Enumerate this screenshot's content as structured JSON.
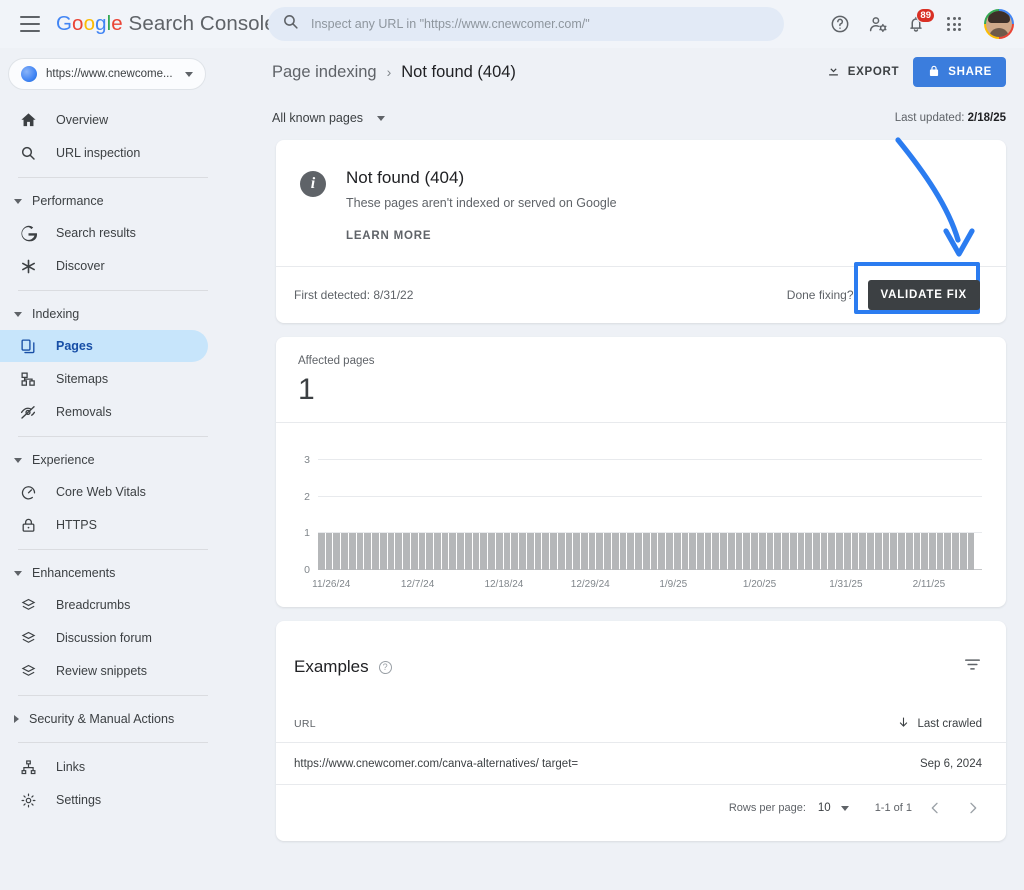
{
  "app": {
    "brand_google": "Google",
    "brand_suffix": " Search Console",
    "menu_icon": "hamburger-icon"
  },
  "search": {
    "placeholder": "Inspect any URL in \"https://www.cnewcomer.com/\"",
    "value": "",
    "icon": "search-icon"
  },
  "top_icons": {
    "help": "help-icon",
    "user_settings": "user-settings-icon",
    "notifications": "bell-icon",
    "notifications_badge": "89",
    "apps": "apps-grid-icon",
    "account": "avatar"
  },
  "sidebar": {
    "property": {
      "label": "https://www.cnewcome...",
      "icon": "globe-icon"
    },
    "items": [
      {
        "label": "Overview",
        "icon": "home-icon",
        "type": "item",
        "active": false
      },
      {
        "label": "URL inspection",
        "icon": "search-icon",
        "type": "item",
        "active": false
      },
      {
        "label": "Performance",
        "icon": "chevron-down-icon",
        "type": "group",
        "expanded": true
      },
      {
        "label": "Search results",
        "icon": "google-g-icon",
        "type": "item",
        "active": false
      },
      {
        "label": "Discover",
        "icon": "asterisk-icon",
        "type": "item",
        "active": false
      },
      {
        "label": "Indexing",
        "icon": "chevron-down-icon",
        "type": "group",
        "expanded": true
      },
      {
        "label": "Pages",
        "icon": "pages-icon",
        "type": "item",
        "active": true
      },
      {
        "label": "Sitemaps",
        "icon": "sitemap-icon",
        "type": "item",
        "active": false
      },
      {
        "label": "Removals",
        "icon": "eye-off-icon",
        "type": "item",
        "active": false
      },
      {
        "label": "Experience",
        "icon": "chevron-down-icon",
        "type": "group",
        "expanded": true
      },
      {
        "label": "Core Web Vitals",
        "icon": "speedometer-icon",
        "type": "item",
        "active": false
      },
      {
        "label": "HTTPS",
        "icon": "lock-icon",
        "type": "item",
        "active": false
      },
      {
        "label": "Enhancements",
        "icon": "chevron-down-icon",
        "type": "group",
        "expanded": true
      },
      {
        "label": "Breadcrumbs",
        "icon": "layers-icon",
        "type": "item",
        "active": false
      },
      {
        "label": "Discussion forum",
        "icon": "layers-icon",
        "type": "item",
        "active": false
      },
      {
        "label": "Review snippets",
        "icon": "layers-icon",
        "type": "item",
        "active": false
      },
      {
        "label": "Security & Manual Actions",
        "icon": "chevron-right-icon",
        "type": "group",
        "expanded": false
      },
      {
        "label": "Links",
        "icon": "links-icon",
        "type": "item",
        "active": false
      },
      {
        "label": "Settings",
        "icon": "gear-icon",
        "type": "item",
        "active": false
      }
    ]
  },
  "header": {
    "breadcrumb_parent": "Page indexing",
    "breadcrumb_separator": "›",
    "breadcrumb_current": "Not found (404)",
    "export_label": "EXPORT",
    "export_icon": "download-icon",
    "share_label": "SHARE",
    "share_icon": "lock-icon"
  },
  "filters": {
    "known_pages_label": "All known pages",
    "known_pages_icon": "chevron-down-icon",
    "last_updated_prefix": "Last updated: ",
    "last_updated_value": "2/18/25"
  },
  "status_card": {
    "icon": "info-icon",
    "icon_glyph": "i",
    "title": "Not found (404)",
    "subtitle": "These pages aren't indexed or served on Google",
    "learn_more": "LEARN MORE",
    "first_detected": "First detected: 8/31/22",
    "done_fixing": "Done fixing?",
    "validate_label": "VALIDATE FIX",
    "highlight_color": "#2b7cf0",
    "validate_bg": "#3c4043",
    "annotation_arrow": "curved-arrow-icon"
  },
  "chart_card": {
    "affected_label": "Affected pages",
    "affected_value": "1"
  },
  "chart_data": {
    "type": "bar",
    "title": "Affected pages",
    "xlabel": "",
    "ylabel": "",
    "ylim": [
      0,
      3
    ],
    "yticks": [
      "0",
      "1",
      "2",
      "3"
    ],
    "grid": true,
    "legend": "none",
    "tick_labels": [
      "11/26/24",
      "12/7/24",
      "12/18/24",
      "12/29/24",
      "1/9/25",
      "1/20/25",
      "1/31/25",
      "2/11/25"
    ],
    "tick_positions_pct": [
      2.0,
      15.0,
      28.0,
      41.0,
      53.5,
      66.5,
      79.5,
      92.0
    ],
    "bar_color": "#b5b7b9",
    "n_bars": 85,
    "values": [
      1,
      1,
      1,
      1,
      1,
      1,
      1,
      1,
      1,
      1,
      1,
      1,
      1,
      1,
      1,
      1,
      1,
      1,
      1,
      1,
      1,
      1,
      1,
      1,
      1,
      1,
      1,
      1,
      1,
      1,
      1,
      1,
      1,
      1,
      1,
      1,
      1,
      1,
      1,
      1,
      1,
      1,
      1,
      1,
      1,
      1,
      1,
      1,
      1,
      1,
      1,
      1,
      1,
      1,
      1,
      1,
      1,
      1,
      1,
      1,
      1,
      1,
      1,
      1,
      1,
      1,
      1,
      1,
      1,
      1,
      1,
      1,
      1,
      1,
      1,
      1,
      1,
      1,
      1,
      1,
      1,
      1,
      1,
      1,
      1
    ]
  },
  "examples": {
    "title": "Examples",
    "help_icon": "help-circle-icon",
    "filter_icon": "filter-icon",
    "columns": {
      "url": "URL",
      "last_crawled": "Last crawled",
      "sort_icon": "arrow-down-icon"
    },
    "rows": [
      {
        "url": "https://www.cnewcomer.com/canva-alternatives/ target=",
        "last_crawled": "Sep 6, 2024"
      }
    ],
    "pagination": {
      "rows_per_page_label": "Rows per page:",
      "rows_per_page_value": "10",
      "rows_per_page_icon": "chevron-down-icon",
      "range": "1-1 of 1",
      "prev_icon": "chevron-left-icon",
      "next_icon": "chevron-right-icon"
    }
  }
}
